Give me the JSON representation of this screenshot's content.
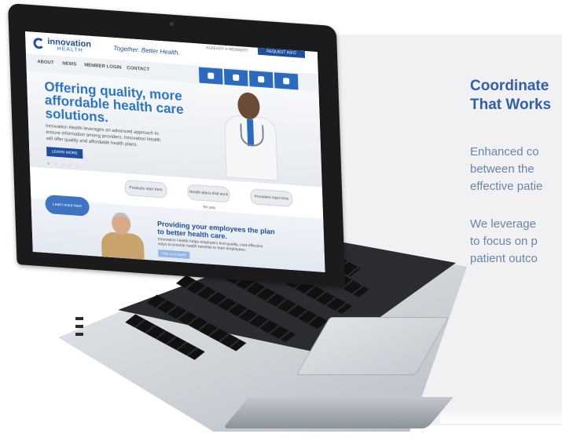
{
  "panel": {
    "title_line1": "Coordinate",
    "title_line2": "That Works",
    "para1_line1": "Enhanced co",
    "para1_line2": "between the",
    "para1_line3": "effective patie",
    "para2_line1": "We leverage",
    "para2_line2": "to focus on p",
    "para2_line3": "patient outco",
    "title_color": "#2f5fae",
    "text_color": "#6b84a8"
  },
  "site": {
    "logo": "innovation",
    "logo_sub": "HEALTH",
    "tagline": "Together. Better Health.",
    "top_link": "ALREADY A MEMBER?",
    "top_button": "REQUEST INFO",
    "nav": [
      "ABOUT",
      "NEWS",
      "MEMBER LOGIN",
      "CONTACT"
    ],
    "tiles": [
      "EMPLOYERS",
      "PROVIDERS",
      "MEMBERS & ENROLLEES",
      "INDIVIDUALS & FAMILIES"
    ],
    "hero_heading": "Offering quality, more affordable health care solutions.",
    "hero_text": "Innovation Health leverages an advanced approach to ensure information among providers. Innovation Health will offer quality and affordable health plans.",
    "hero_button": "LEARN MORE",
    "hero_dots": "● ○ ○ ○ ○",
    "pills": [
      "Products start here",
      "Health plans that work for you",
      "Providers start here"
    ],
    "bubble": "Learn more here",
    "lower_heading": "Providing your employees the plan to better health care.",
    "lower_text": "Innovation Health helps employers find quality, cost-effective ways to provide health benefits to their employees.",
    "lower_button": "FIND OUT MORE",
    "brand_blue": "#1f4f9c",
    "accent_blue": "#2a74c9"
  }
}
